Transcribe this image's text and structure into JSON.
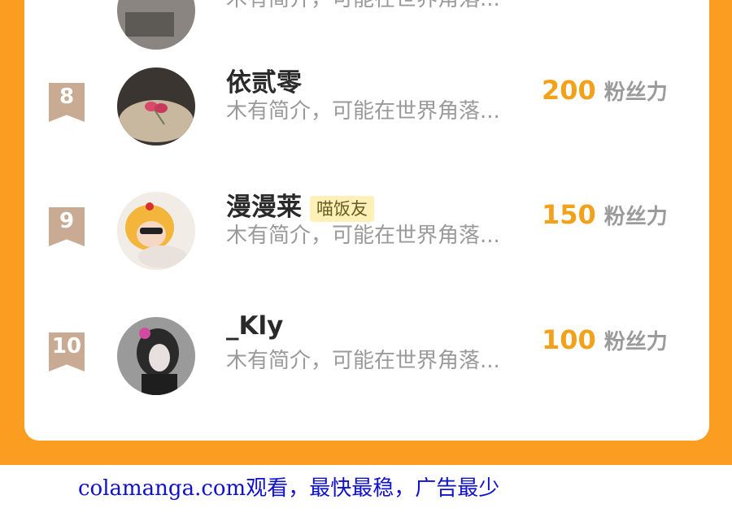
{
  "ranking": {
    "partial_row": {
      "desc": "木有简介，可能在世界角落..."
    },
    "rows": [
      {
        "rank": "8",
        "name": "依贰零",
        "badge": "",
        "desc": "木有简介，可能在世界角落...",
        "score": "200",
        "unit": "粉丝力"
      },
      {
        "rank": "9",
        "name": "漫漫莱",
        "badge": "喵饭友",
        "desc": "木有简介，可能在世界角落...",
        "score": "150",
        "unit": "粉丝力"
      },
      {
        "rank": "10",
        "name": "_Kly",
        "badge": "",
        "desc": "木有简介，可能在世界角落...",
        "score": "100",
        "unit": "粉丝力"
      }
    ]
  },
  "watermark": {
    "text": "colamanga.com观看，最快最稳，广告最少"
  },
  "colors": {
    "frame": "#fb9d20",
    "score": "#f2a21a",
    "rank_badge": "#c9aa93",
    "watermark": "#1010d0"
  }
}
